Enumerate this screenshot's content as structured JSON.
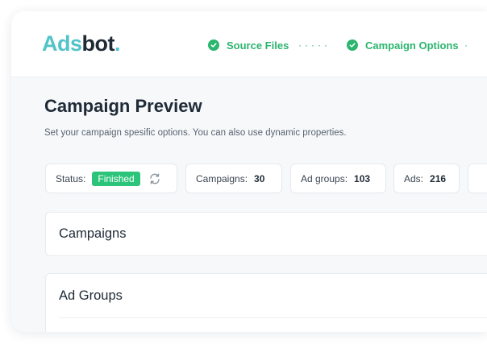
{
  "brand": {
    "name_part1": "Ads",
    "name_part2": "bot",
    "name_dot": "."
  },
  "steps": [
    {
      "label": "Source Files",
      "status": "completed"
    },
    {
      "label": "Campaign Options",
      "status": "completed"
    }
  ],
  "page": {
    "title": "Campaign Preview",
    "subtitle": "Set your campaign spesific options. You can also use dynamic properties."
  },
  "stats": {
    "status_label": "Status:",
    "status_value": "Finished",
    "campaigns_label": "Campaigns:",
    "campaigns_value": "30",
    "ad_groups_label": "Ad groups:",
    "ad_groups_value": "103",
    "ads_label": "Ads:",
    "ads_value": "216"
  },
  "sections": [
    {
      "title": "Campaigns"
    },
    {
      "title": "Ad Groups"
    }
  ],
  "colors": {
    "accent_green": "#2bb56f",
    "badge_green": "#2bc47a",
    "logo_teal": "#52c4c9",
    "text_dark": "#1f2a36"
  }
}
